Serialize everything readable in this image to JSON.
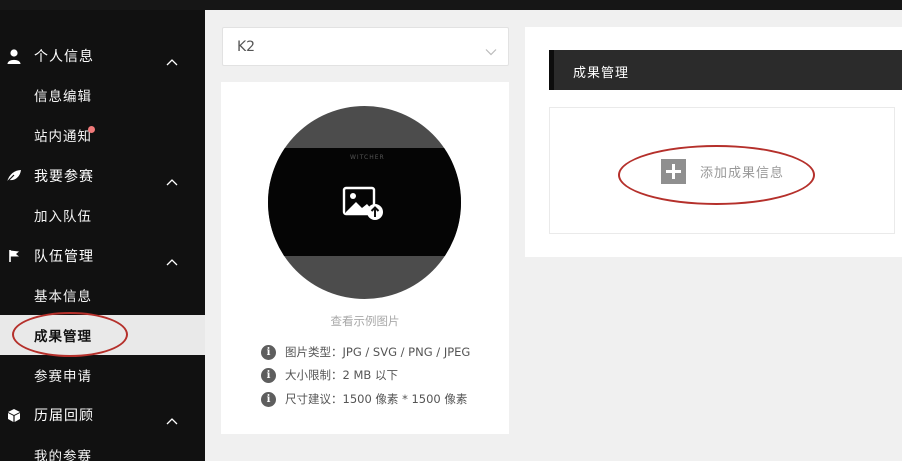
{
  "sidebar": {
    "sections": [
      {
        "label": "个人信息",
        "icon": "user-icon",
        "items": [
          "信息编辑",
          "站内通知"
        ]
      },
      {
        "label": "我要参赛",
        "icon": "leaf-icon",
        "items": [
          "加入队伍"
        ]
      },
      {
        "label": "队伍管理",
        "icon": "flag-icon",
        "items": [
          "基本信息",
          "成果管理",
          "参赛申请"
        ]
      },
      {
        "label": "历届回顾",
        "icon": "cube-icon",
        "items": [
          "我的参赛"
        ]
      }
    ],
    "active_item": "成果管理",
    "notification_dot_color": "#f07a7a"
  },
  "team_select": {
    "value": "K2"
  },
  "image_card": {
    "watermark": "WITCHER",
    "sample_link": "查看示例图片",
    "info": [
      {
        "icon": "info-icon",
        "text": "图片类型：JPG / SVG / PNG / JPEG"
      },
      {
        "icon": "info-icon",
        "text": "大小限制：2 MB 以下"
      },
      {
        "icon": "info-icon",
        "text": "尺寸建议：1500 像素 * 1500 像素"
      }
    ]
  },
  "achievements": {
    "title": "成果管理",
    "add_label": "添加成果信息"
  },
  "colors": {
    "sidebar_bg": "#111111",
    "active_bg": "#e9e9e9",
    "panel_header_bg": "#2b2b2b",
    "annotation_red": "#b5302b"
  }
}
